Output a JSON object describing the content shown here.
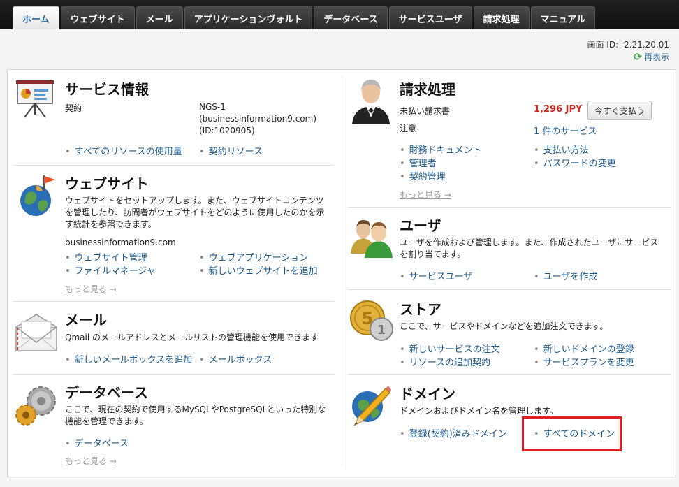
{
  "nav": {
    "tabs": [
      "ホーム",
      "ウェブサイト",
      "メール",
      "アプリケーションヴォルト",
      "データベース",
      "サービスユーザ",
      "請求処理",
      "マニュアル"
    ]
  },
  "screen": {
    "id_label": "画面 ID:",
    "id_value": "2.21.20.01",
    "refresh": "再表示"
  },
  "service_info": {
    "title": "サービス情報",
    "contract_label": "契約",
    "contract_value_1": "NGS-1",
    "contract_value_2": "(businessinformation9.com)",
    "contract_value_3": "(ID:1020905)",
    "links": [
      "すべてのリソースの使用量",
      "契約リソース"
    ]
  },
  "website": {
    "title": "ウェブサイト",
    "description": "ウェブサイトをセットアップします。また、ウェブサイトコンテンツを管理したり、訪問者がウェブサイトをどのように使用したのかを示す統計を参照できます。",
    "domain": "businessinformation9.com",
    "links": [
      "ウェブサイト管理",
      "ウェブアプリケーション",
      "ファイルマネージャ",
      "新しいウェブサイトを追加"
    ],
    "more": "もっと見る →"
  },
  "mail": {
    "title": "メール",
    "description": "Qmail のメールアドレスとメールリストの管理機能を使用できます",
    "links": [
      "新しいメールボックスを追加",
      "メールボックス"
    ]
  },
  "database": {
    "title": "データベース",
    "description": "ここで、現在の契約で使用するMySQLやPostgreSQLといった特別な機能を管理できます。",
    "links": [
      "データベース"
    ],
    "more": "もっと見る →"
  },
  "billing": {
    "title": "請求処理",
    "unpaid_label": "未払い請求書",
    "unpaid_amount": "1,296 JPY",
    "pay_button": "今すぐ支払う",
    "notice_label": "注意",
    "notice_value": "1 件のサービス",
    "links": [
      "財務ドキュメント",
      "支払い方法",
      "管理者",
      "パスワードの変更",
      "契約管理"
    ],
    "more": "もっと見る →"
  },
  "users": {
    "title": "ユーザ",
    "description": "ユーザを作成および管理します。また、作成されたユーザにサービスを割り当てます。",
    "links": [
      "サービスユーザ",
      "ユーザを作成"
    ]
  },
  "store": {
    "title": "ストア",
    "description": "ここで、サービスやドメインなどを追加注文できます。",
    "links": [
      "新しいサービスの注文",
      "新しいドメインの登録",
      "リソースの追加契約",
      "サービスプランを変更"
    ]
  },
  "domains": {
    "title": "ドメイン",
    "description": "ドメインおよびドメイン名を管理します。",
    "links": [
      "登録(契約)済みドメイン",
      "すべてのドメイン"
    ]
  },
  "colors": {
    "link": "#1d5a8c",
    "amount": "#d0281b",
    "highlight": "#e02020",
    "active_tab_text": "#2b6aa3"
  }
}
